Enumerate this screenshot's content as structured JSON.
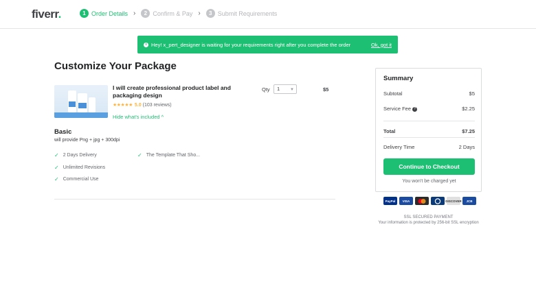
{
  "header": {
    "logo": "fiverr",
    "logo_dot": ".",
    "steps": [
      {
        "num": "1",
        "label": "Order Details"
      },
      {
        "num": "2",
        "label": "Confirm & Pay"
      },
      {
        "num": "3",
        "label": "Submit Requirements"
      }
    ]
  },
  "banner": {
    "message": "Hey! x_pert_designer is waiting for your requirements right after you complete the order",
    "ok_label": "Ok, got it"
  },
  "main": {
    "title": "Customize Your Package",
    "gig": {
      "title": "I will create professional product label and packaging design",
      "stars": "★★★★★",
      "score": "5.0",
      "reviews": "(103 reviews)",
      "hide_link": "Hide what's included ^",
      "qty_label": "Qty",
      "qty_value": "1",
      "price": "$5"
    },
    "package": {
      "name": "Basic",
      "description": "will provide Png + jpg + 300dpi",
      "features": [
        "2 Days Delivery",
        "The Template That Sho...",
        "Unlimited Revisions",
        "Commercial Use"
      ]
    }
  },
  "summary": {
    "title": "Summary",
    "subtotal_label": "Subtotal",
    "subtotal_value": "$5",
    "fee_label": "Service Fee",
    "fee_value": "$2.25",
    "total_label": "Total",
    "total_value": "$7.25",
    "delivery_label": "Delivery Time",
    "delivery_value": "2 Days",
    "checkout_label": "Continue to Checkout",
    "no_charge": "You won't be charged yet"
  },
  "payment": {
    "cards": [
      {
        "label": "PayPal",
        "color": "#003087"
      },
      {
        "label": "VISA",
        "color": "#1a4ba0"
      },
      {
        "label": "MC",
        "color": "#2b2b2b"
      },
      {
        "label": "Diners",
        "color": "#0a3a7a"
      },
      {
        "label": "DISCOVER",
        "color": "#e0e0e0"
      },
      {
        "label": "JCB",
        "color": "#1a4ba0"
      }
    ],
    "ssl_title": "SSL SECURED PAYMENT",
    "ssl_text": "Your information is protected by 256-bit SSL encryption"
  },
  "colors": {
    "accent": "#1dbf73",
    "star": "#ffb33e"
  }
}
